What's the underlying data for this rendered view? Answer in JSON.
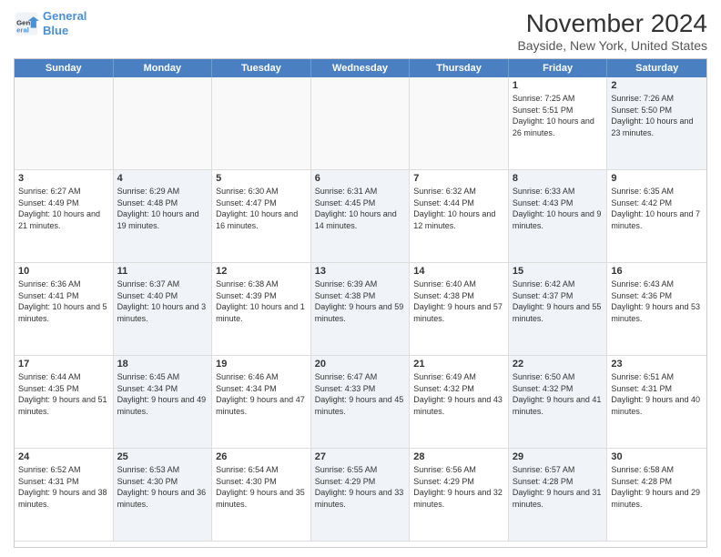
{
  "logo": {
    "line1": "General",
    "line2": "Blue"
  },
  "title": "November 2024",
  "subtitle": "Bayside, New York, United States",
  "days": [
    "Sunday",
    "Monday",
    "Tuesday",
    "Wednesday",
    "Thursday",
    "Friday",
    "Saturday"
  ],
  "cells": [
    {
      "day": "",
      "text": "",
      "shade": false,
      "empty": true
    },
    {
      "day": "",
      "text": "",
      "shade": false,
      "empty": true
    },
    {
      "day": "",
      "text": "",
      "shade": false,
      "empty": true
    },
    {
      "day": "",
      "text": "",
      "shade": false,
      "empty": true
    },
    {
      "day": "",
      "text": "",
      "shade": false,
      "empty": true
    },
    {
      "day": "1",
      "text": "Sunrise: 7:25 AM\nSunset: 5:51 PM\nDaylight: 10 hours and 26 minutes.",
      "shade": false,
      "empty": false
    },
    {
      "day": "2",
      "text": "Sunrise: 7:26 AM\nSunset: 5:50 PM\nDaylight: 10 hours and 23 minutes.",
      "shade": true,
      "empty": false
    },
    {
      "day": "3",
      "text": "Sunrise: 6:27 AM\nSunset: 4:49 PM\nDaylight: 10 hours and 21 minutes.",
      "shade": false,
      "empty": false
    },
    {
      "day": "4",
      "text": "Sunrise: 6:29 AM\nSunset: 4:48 PM\nDaylight: 10 hours and 19 minutes.",
      "shade": true,
      "empty": false
    },
    {
      "day": "5",
      "text": "Sunrise: 6:30 AM\nSunset: 4:47 PM\nDaylight: 10 hours and 16 minutes.",
      "shade": false,
      "empty": false
    },
    {
      "day": "6",
      "text": "Sunrise: 6:31 AM\nSunset: 4:45 PM\nDaylight: 10 hours and 14 minutes.",
      "shade": true,
      "empty": false
    },
    {
      "day": "7",
      "text": "Sunrise: 6:32 AM\nSunset: 4:44 PM\nDaylight: 10 hours and 12 minutes.",
      "shade": false,
      "empty": false
    },
    {
      "day": "8",
      "text": "Sunrise: 6:33 AM\nSunset: 4:43 PM\nDaylight: 10 hours and 9 minutes.",
      "shade": true,
      "empty": false
    },
    {
      "day": "9",
      "text": "Sunrise: 6:35 AM\nSunset: 4:42 PM\nDaylight: 10 hours and 7 minutes.",
      "shade": false,
      "empty": false
    },
    {
      "day": "10",
      "text": "Sunrise: 6:36 AM\nSunset: 4:41 PM\nDaylight: 10 hours and 5 minutes.",
      "shade": false,
      "empty": false
    },
    {
      "day": "11",
      "text": "Sunrise: 6:37 AM\nSunset: 4:40 PM\nDaylight: 10 hours and 3 minutes.",
      "shade": true,
      "empty": false
    },
    {
      "day": "12",
      "text": "Sunrise: 6:38 AM\nSunset: 4:39 PM\nDaylight: 10 hours and 1 minute.",
      "shade": false,
      "empty": false
    },
    {
      "day": "13",
      "text": "Sunrise: 6:39 AM\nSunset: 4:38 PM\nDaylight: 9 hours and 59 minutes.",
      "shade": true,
      "empty": false
    },
    {
      "day": "14",
      "text": "Sunrise: 6:40 AM\nSunset: 4:38 PM\nDaylight: 9 hours and 57 minutes.",
      "shade": false,
      "empty": false
    },
    {
      "day": "15",
      "text": "Sunrise: 6:42 AM\nSunset: 4:37 PM\nDaylight: 9 hours and 55 minutes.",
      "shade": true,
      "empty": false
    },
    {
      "day": "16",
      "text": "Sunrise: 6:43 AM\nSunset: 4:36 PM\nDaylight: 9 hours and 53 minutes.",
      "shade": false,
      "empty": false
    },
    {
      "day": "17",
      "text": "Sunrise: 6:44 AM\nSunset: 4:35 PM\nDaylight: 9 hours and 51 minutes.",
      "shade": false,
      "empty": false
    },
    {
      "day": "18",
      "text": "Sunrise: 6:45 AM\nSunset: 4:34 PM\nDaylight: 9 hours and 49 minutes.",
      "shade": true,
      "empty": false
    },
    {
      "day": "19",
      "text": "Sunrise: 6:46 AM\nSunset: 4:34 PM\nDaylight: 9 hours and 47 minutes.",
      "shade": false,
      "empty": false
    },
    {
      "day": "20",
      "text": "Sunrise: 6:47 AM\nSunset: 4:33 PM\nDaylight: 9 hours and 45 minutes.",
      "shade": true,
      "empty": false
    },
    {
      "day": "21",
      "text": "Sunrise: 6:49 AM\nSunset: 4:32 PM\nDaylight: 9 hours and 43 minutes.",
      "shade": false,
      "empty": false
    },
    {
      "day": "22",
      "text": "Sunrise: 6:50 AM\nSunset: 4:32 PM\nDaylight: 9 hours and 41 minutes.",
      "shade": true,
      "empty": false
    },
    {
      "day": "23",
      "text": "Sunrise: 6:51 AM\nSunset: 4:31 PM\nDaylight: 9 hours and 40 minutes.",
      "shade": false,
      "empty": false
    },
    {
      "day": "24",
      "text": "Sunrise: 6:52 AM\nSunset: 4:31 PM\nDaylight: 9 hours and 38 minutes.",
      "shade": false,
      "empty": false
    },
    {
      "day": "25",
      "text": "Sunrise: 6:53 AM\nSunset: 4:30 PM\nDaylight: 9 hours and 36 minutes.",
      "shade": true,
      "empty": false
    },
    {
      "day": "26",
      "text": "Sunrise: 6:54 AM\nSunset: 4:30 PM\nDaylight: 9 hours and 35 minutes.",
      "shade": false,
      "empty": false
    },
    {
      "day": "27",
      "text": "Sunrise: 6:55 AM\nSunset: 4:29 PM\nDaylight: 9 hours and 33 minutes.",
      "shade": true,
      "empty": false
    },
    {
      "day": "28",
      "text": "Sunrise: 6:56 AM\nSunset: 4:29 PM\nDaylight: 9 hours and 32 minutes.",
      "shade": false,
      "empty": false
    },
    {
      "day": "29",
      "text": "Sunrise: 6:57 AM\nSunset: 4:28 PM\nDaylight: 9 hours and 31 minutes.",
      "shade": true,
      "empty": false
    },
    {
      "day": "30",
      "text": "Sunrise: 6:58 AM\nSunset: 4:28 PM\nDaylight: 9 hours and 29 minutes.",
      "shade": false,
      "empty": false
    }
  ]
}
